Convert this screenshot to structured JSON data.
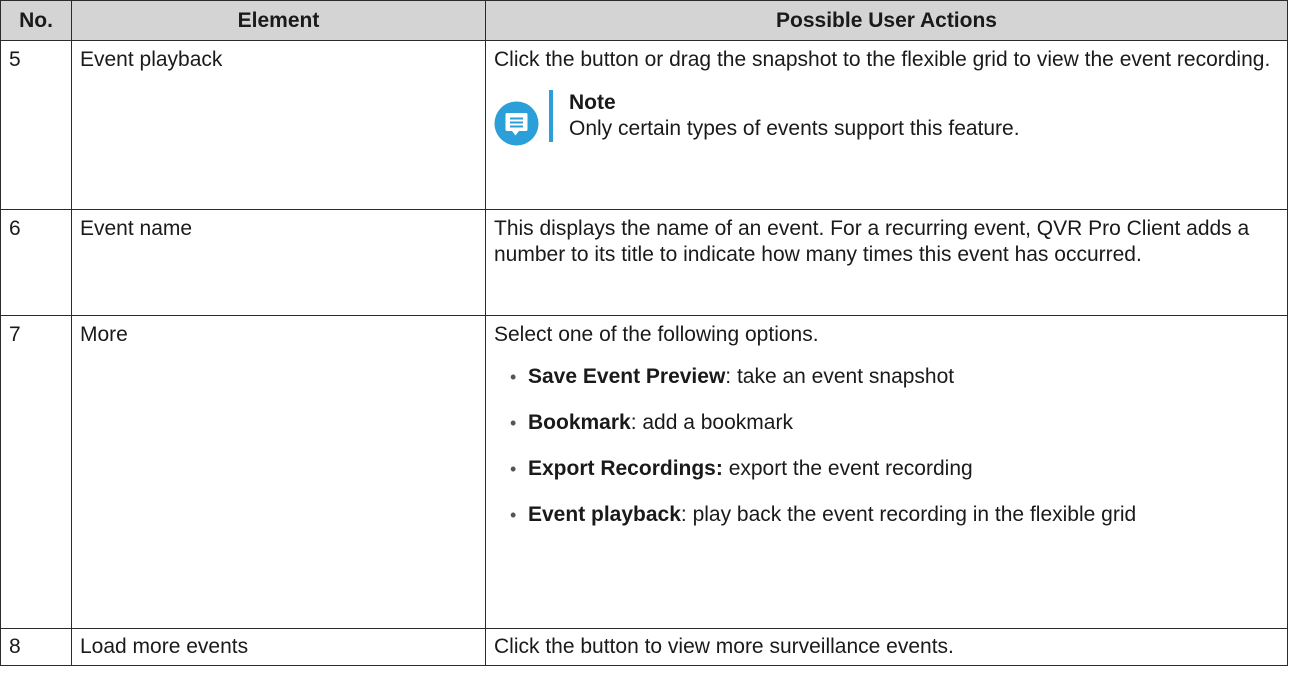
{
  "headers": {
    "no": "No.",
    "element": "Element",
    "actions": "Possible User Actions"
  },
  "rows": [
    {
      "no": "5",
      "element": "Event playback",
      "action": "Click the button or drag the snapshot to the flexible grid to view the event recording.",
      "note": {
        "title": "Note",
        "text": "Only certain types of events support this feature."
      }
    },
    {
      "no": "6",
      "element": "Event name",
      "action": "This displays the name of an event. For a recurring event, QVR Pro Client adds a number to its title to indicate how many times this event has occurred."
    },
    {
      "no": "7",
      "element": "More",
      "action": "Select one of the following options.",
      "options": [
        {
          "term": "Save Event Preview",
          "desc": ": take an event snapshot"
        },
        {
          "term": "Bookmark",
          "desc": ": add a bookmark"
        },
        {
          "term": "Export Recordings:",
          "desc": " export the event recording"
        },
        {
          "term": "Event playback",
          "desc": ": play back the event recording in the flexible grid"
        }
      ]
    },
    {
      "no": "8",
      "element": "Load more events",
      "action": "Click the button to view more surveillance events."
    }
  ],
  "colors": {
    "header_bg": "#d4d4d4",
    "note_accent": "#2a9fd8",
    "note_icon_bg": "#2a9fd8"
  },
  "icons": {
    "note": "note-icon"
  }
}
